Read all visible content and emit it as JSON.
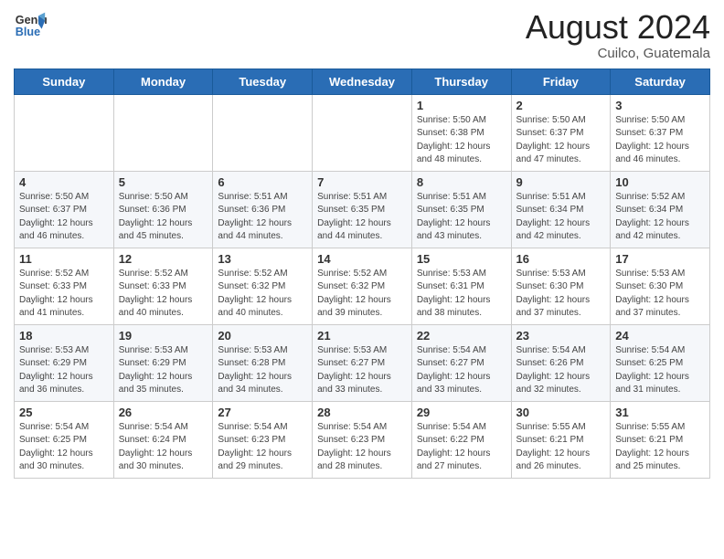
{
  "logo": {
    "line1": "General",
    "line2": "Blue"
  },
  "title": "August 2024",
  "subtitle": "Cuilco, Guatemala",
  "days_of_week": [
    "Sunday",
    "Monday",
    "Tuesday",
    "Wednesday",
    "Thursday",
    "Friday",
    "Saturday"
  ],
  "weeks": [
    [
      {
        "day": "",
        "info": ""
      },
      {
        "day": "",
        "info": ""
      },
      {
        "day": "",
        "info": ""
      },
      {
        "day": "",
        "info": ""
      },
      {
        "day": "1",
        "info": "Sunrise: 5:50 AM\nSunset: 6:38 PM\nDaylight: 12 hours\nand 48 minutes."
      },
      {
        "day": "2",
        "info": "Sunrise: 5:50 AM\nSunset: 6:37 PM\nDaylight: 12 hours\nand 47 minutes."
      },
      {
        "day": "3",
        "info": "Sunrise: 5:50 AM\nSunset: 6:37 PM\nDaylight: 12 hours\nand 46 minutes."
      }
    ],
    [
      {
        "day": "4",
        "info": "Sunrise: 5:50 AM\nSunset: 6:37 PM\nDaylight: 12 hours\nand 46 minutes."
      },
      {
        "day": "5",
        "info": "Sunrise: 5:50 AM\nSunset: 6:36 PM\nDaylight: 12 hours\nand 45 minutes."
      },
      {
        "day": "6",
        "info": "Sunrise: 5:51 AM\nSunset: 6:36 PM\nDaylight: 12 hours\nand 44 minutes."
      },
      {
        "day": "7",
        "info": "Sunrise: 5:51 AM\nSunset: 6:35 PM\nDaylight: 12 hours\nand 44 minutes."
      },
      {
        "day": "8",
        "info": "Sunrise: 5:51 AM\nSunset: 6:35 PM\nDaylight: 12 hours\nand 43 minutes."
      },
      {
        "day": "9",
        "info": "Sunrise: 5:51 AM\nSunset: 6:34 PM\nDaylight: 12 hours\nand 42 minutes."
      },
      {
        "day": "10",
        "info": "Sunrise: 5:52 AM\nSunset: 6:34 PM\nDaylight: 12 hours\nand 42 minutes."
      }
    ],
    [
      {
        "day": "11",
        "info": "Sunrise: 5:52 AM\nSunset: 6:33 PM\nDaylight: 12 hours\nand 41 minutes."
      },
      {
        "day": "12",
        "info": "Sunrise: 5:52 AM\nSunset: 6:33 PM\nDaylight: 12 hours\nand 40 minutes."
      },
      {
        "day": "13",
        "info": "Sunrise: 5:52 AM\nSunset: 6:32 PM\nDaylight: 12 hours\nand 40 minutes."
      },
      {
        "day": "14",
        "info": "Sunrise: 5:52 AM\nSunset: 6:32 PM\nDaylight: 12 hours\nand 39 minutes."
      },
      {
        "day": "15",
        "info": "Sunrise: 5:53 AM\nSunset: 6:31 PM\nDaylight: 12 hours\nand 38 minutes."
      },
      {
        "day": "16",
        "info": "Sunrise: 5:53 AM\nSunset: 6:30 PM\nDaylight: 12 hours\nand 37 minutes."
      },
      {
        "day": "17",
        "info": "Sunrise: 5:53 AM\nSunset: 6:30 PM\nDaylight: 12 hours\nand 37 minutes."
      }
    ],
    [
      {
        "day": "18",
        "info": "Sunrise: 5:53 AM\nSunset: 6:29 PM\nDaylight: 12 hours\nand 36 minutes."
      },
      {
        "day": "19",
        "info": "Sunrise: 5:53 AM\nSunset: 6:29 PM\nDaylight: 12 hours\nand 35 minutes."
      },
      {
        "day": "20",
        "info": "Sunrise: 5:53 AM\nSunset: 6:28 PM\nDaylight: 12 hours\nand 34 minutes."
      },
      {
        "day": "21",
        "info": "Sunrise: 5:53 AM\nSunset: 6:27 PM\nDaylight: 12 hours\nand 33 minutes."
      },
      {
        "day": "22",
        "info": "Sunrise: 5:54 AM\nSunset: 6:27 PM\nDaylight: 12 hours\nand 33 minutes."
      },
      {
        "day": "23",
        "info": "Sunrise: 5:54 AM\nSunset: 6:26 PM\nDaylight: 12 hours\nand 32 minutes."
      },
      {
        "day": "24",
        "info": "Sunrise: 5:54 AM\nSunset: 6:25 PM\nDaylight: 12 hours\nand 31 minutes."
      }
    ],
    [
      {
        "day": "25",
        "info": "Sunrise: 5:54 AM\nSunset: 6:25 PM\nDaylight: 12 hours\nand 30 minutes."
      },
      {
        "day": "26",
        "info": "Sunrise: 5:54 AM\nSunset: 6:24 PM\nDaylight: 12 hours\nand 30 minutes."
      },
      {
        "day": "27",
        "info": "Sunrise: 5:54 AM\nSunset: 6:23 PM\nDaylight: 12 hours\nand 29 minutes."
      },
      {
        "day": "28",
        "info": "Sunrise: 5:54 AM\nSunset: 6:23 PM\nDaylight: 12 hours\nand 28 minutes."
      },
      {
        "day": "29",
        "info": "Sunrise: 5:54 AM\nSunset: 6:22 PM\nDaylight: 12 hours\nand 27 minutes."
      },
      {
        "day": "30",
        "info": "Sunrise: 5:55 AM\nSunset: 6:21 PM\nDaylight: 12 hours\nand 26 minutes."
      },
      {
        "day": "31",
        "info": "Sunrise: 5:55 AM\nSunset: 6:21 PM\nDaylight: 12 hours\nand 25 minutes."
      }
    ]
  ]
}
